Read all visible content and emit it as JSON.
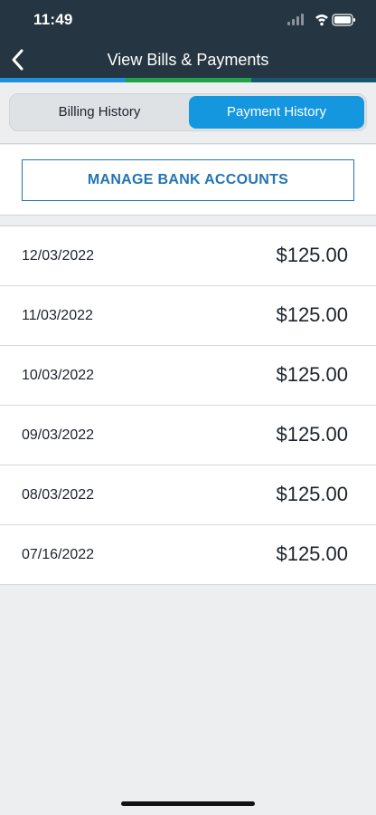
{
  "status_bar": {
    "time": "11:49"
  },
  "nav": {
    "title": "View Bills & Payments"
  },
  "colors": {
    "header_bg": "#253642",
    "accent_blue": "#1597e0",
    "accent_green": "#1fa34a",
    "link_blue": "#2274b5"
  },
  "tabs": [
    {
      "label": "Billing History",
      "selected": false
    },
    {
      "label": "Payment History",
      "selected": true
    }
  ],
  "manage_button": {
    "label": "MANAGE BANK ACCOUNTS"
  },
  "payments": [
    {
      "date": "12/03/2022",
      "amount": "$125.00"
    },
    {
      "date": "11/03/2022",
      "amount": "$125.00"
    },
    {
      "date": "10/03/2022",
      "amount": "$125.00"
    },
    {
      "date": "09/03/2022",
      "amount": "$125.00"
    },
    {
      "date": "08/03/2022",
      "amount": "$125.00"
    },
    {
      "date": "07/16/2022",
      "amount": "$125.00"
    }
  ]
}
